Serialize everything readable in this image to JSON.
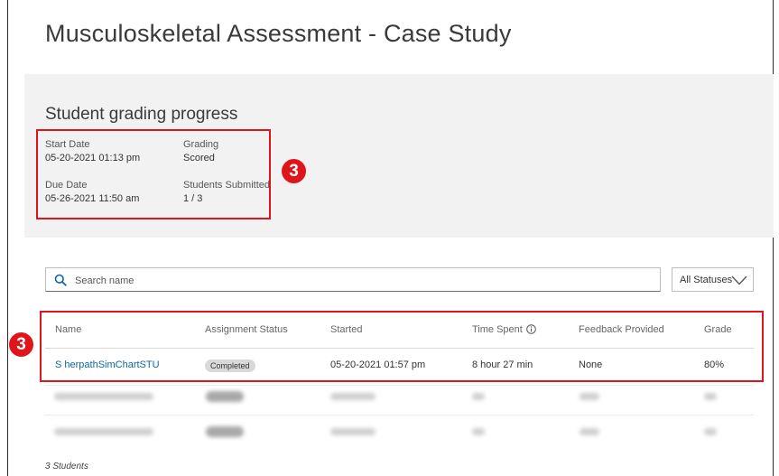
{
  "page": {
    "title": "Musculoskeletal Assessment - Case Study"
  },
  "summary": {
    "heading": "Student grading progress",
    "start_date_label": "Start Date",
    "start_date_value": "05-20-2021 01:13 pm",
    "grading_label": "Grading",
    "grading_value": "Scored",
    "due_date_label": "Due Date",
    "due_date_value": "05-26-2021 11:50 am",
    "students_submitted_label": "Students Submitted",
    "students_submitted_value": "1 / 3"
  },
  "callouts": {
    "summary_marker": "3",
    "table_marker": "3",
    "color": "#e0151b"
  },
  "filters": {
    "search_placeholder": "Search name",
    "search_icon": "search-icon",
    "status_select_value": "All Statuses",
    "status_select_icon": "chevron-down-icon"
  },
  "table": {
    "columns": [
      "Name",
      "Assignment Status",
      "Started",
      "Time Spent",
      "Feedback Provided",
      "Grade"
    ],
    "time_spent_icon": "info-icon",
    "rows": [
      {
        "name": "S herpathSimChartSTU",
        "status": "Completed",
        "started": "05-20-2021 01:57 pm",
        "time_spent": "8 hour 27 min",
        "feedback": "None",
        "grade": "80%"
      }
    ],
    "link_color": "#0b67a8"
  },
  "footer": {
    "students_count": "3 Students"
  }
}
